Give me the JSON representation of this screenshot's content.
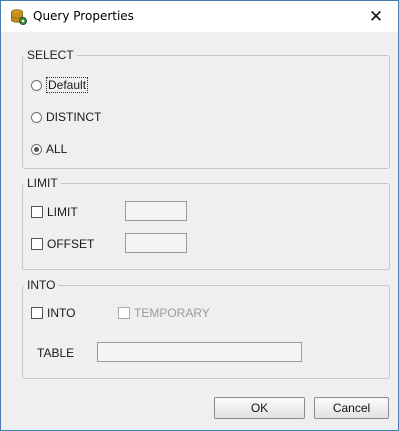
{
  "window": {
    "title": "Query Properties",
    "close_glyph": "✕",
    "app_icon": "database-gear-icon"
  },
  "select_group": {
    "legend": "SELECT",
    "options": [
      {
        "label": "Default",
        "checked": false,
        "focused": true
      },
      {
        "label": "DISTINCT",
        "checked": false
      },
      {
        "label": "ALL",
        "checked": true
      }
    ]
  },
  "limit_group": {
    "legend": "LIMIT",
    "limit_label": "LIMIT",
    "limit_checked": false,
    "limit_value": "",
    "offset_label": "OFFSET",
    "offset_checked": false,
    "offset_value": ""
  },
  "into_group": {
    "legend": "INTO",
    "into_label": "INTO",
    "into_checked": false,
    "temporary_label": "TEMPORARY",
    "temporary_checked": false,
    "temporary_enabled": false,
    "table_label": "TABLE",
    "table_value": ""
  },
  "buttons": {
    "ok": "OK",
    "cancel": "Cancel"
  },
  "colors": {
    "window_border": "#4a78b3",
    "dialog_background": "#efefef",
    "disabled_text": "#9a9a9a"
  }
}
